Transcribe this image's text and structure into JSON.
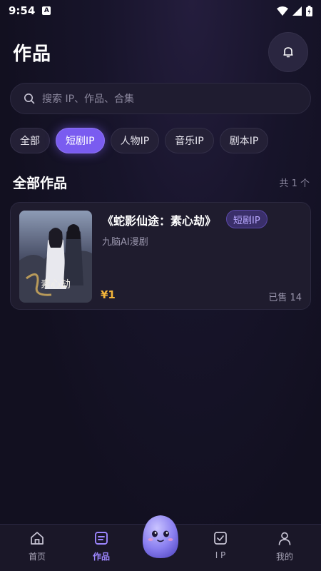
{
  "status": {
    "time": "9:54",
    "a_badge": "A"
  },
  "header": {
    "title": "作品"
  },
  "search": {
    "placeholder": "搜索 IP、作品、合集"
  },
  "chips": [
    "全部",
    "短剧IP",
    "人物IP",
    "音乐IP",
    "剧本IP"
  ],
  "active_chip": "短剧IP",
  "section": {
    "title": "全部作品",
    "count": "共 1 个"
  },
  "works": [
    {
      "title": "《蛇影仙途：素心劫》",
      "tag": "短剧IP",
      "author": "九脑AI漫剧",
      "price": "¥1",
      "sold": "已售 14",
      "cover_text": "蛇影仙途 素心劫"
    }
  ],
  "tabbar": [
    {
      "label": "首页",
      "icon": "home-icon"
    },
    {
      "label": "作品",
      "icon": "works-icon",
      "active": true
    },
    {
      "label": "I P",
      "icon": "ip-check-icon"
    },
    {
      "label": "我的",
      "icon": "user-icon"
    }
  ],
  "colors": {
    "accent": "#7a5cf0",
    "price": "#f3b53a",
    "background": "#121020"
  }
}
